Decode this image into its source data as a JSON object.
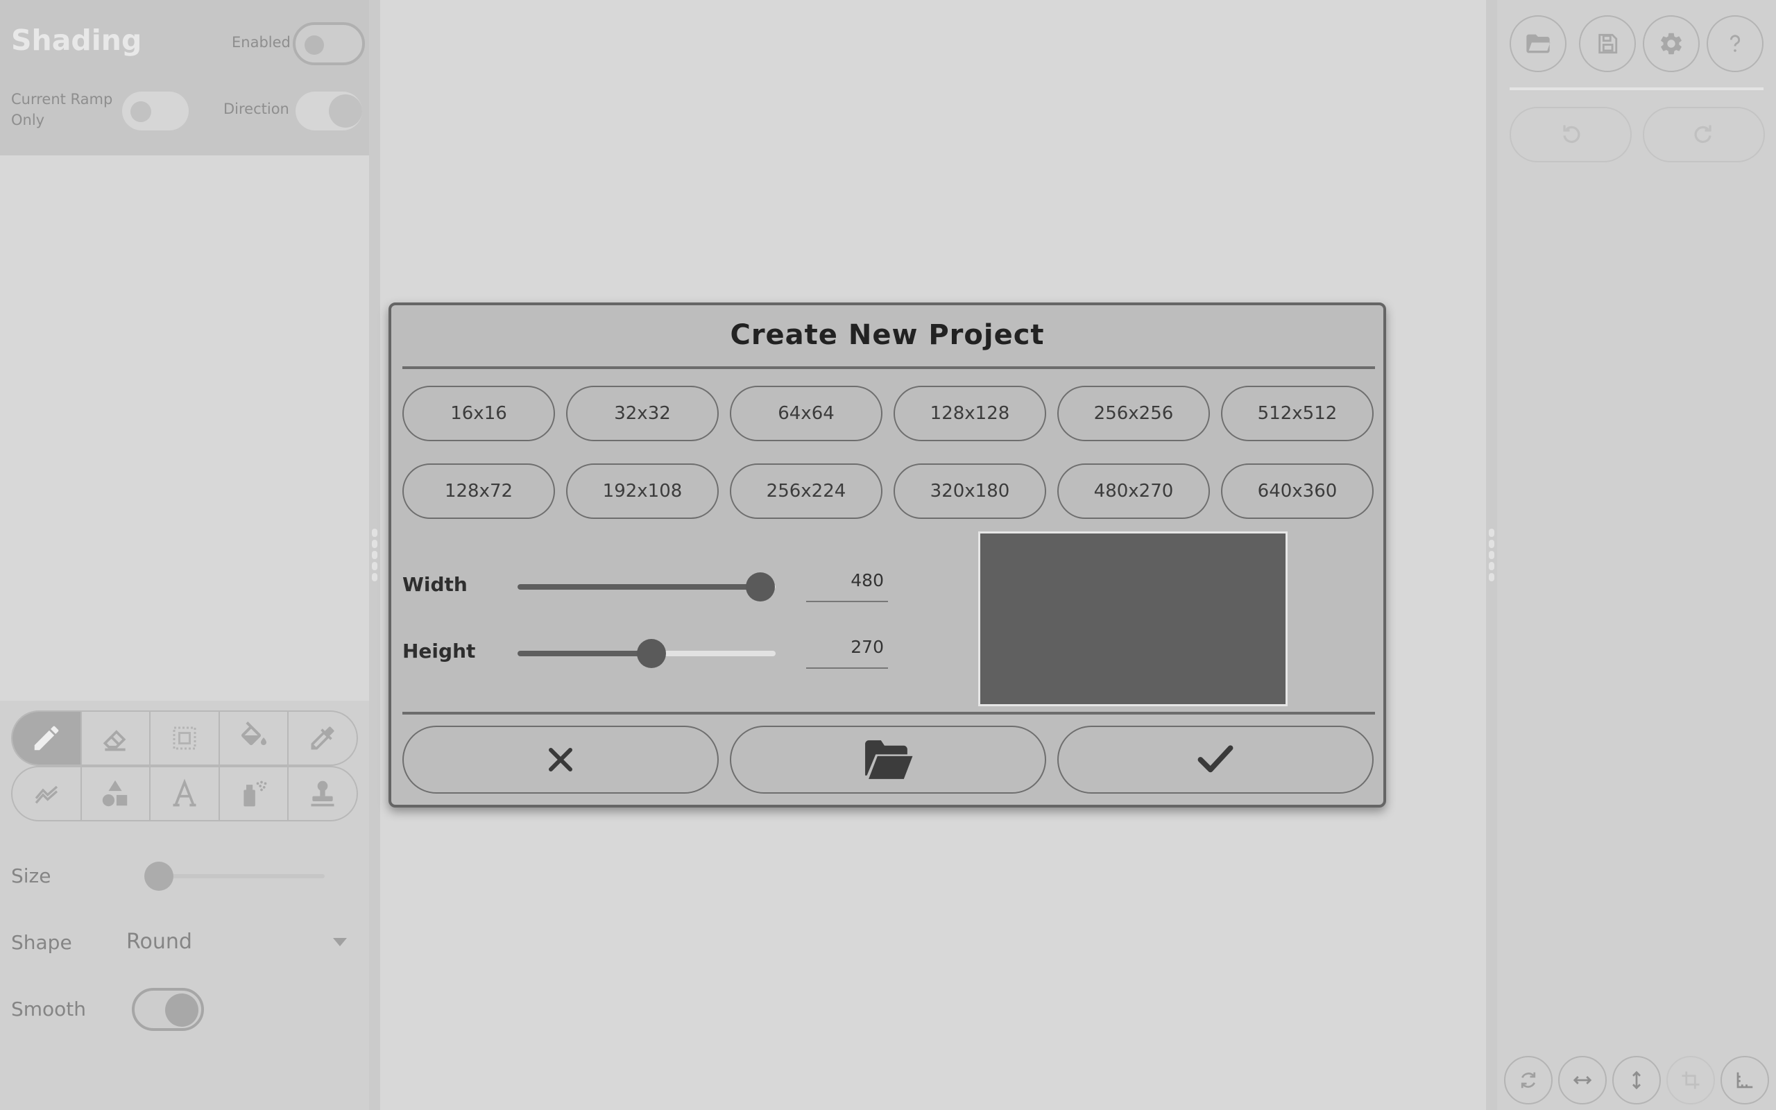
{
  "left_panel": {
    "shading": {
      "title": "Shading",
      "enabled_label": "Enabled",
      "current_ramp_line1": "Current Ramp",
      "current_ramp_line2": "Only",
      "direction_label": "Direction"
    },
    "tools_row1": [
      "pencil-icon",
      "eraser-icon",
      "selection-icon",
      "bucket-fill-icon",
      "eyedropper-icon"
    ],
    "tools_row2": [
      "shading-icon",
      "shapes-icon",
      "text-icon",
      "spray-icon",
      "stamp-icon"
    ],
    "active_tool": "pencil-icon",
    "brush": {
      "size_label": "Size",
      "size_value_fraction": 0.0,
      "shape_label": "Shape",
      "shape_value": "Round",
      "smooth_label": "Smooth",
      "smooth_on": true
    }
  },
  "right_panel": {
    "top_buttons": [
      "open-folder-icon",
      "save-icon",
      "settings-gear-icon",
      "help-question-icon"
    ],
    "history_buttons": [
      "undo-icon",
      "redo-icon"
    ],
    "bottom_buttons": [
      "rotate-icon",
      "flip-horizontal-icon",
      "flip-vertical-icon",
      "crop-icon",
      "ruler-icon"
    ]
  },
  "dialog": {
    "title": "Create New Project",
    "presets_row1": [
      "16x16",
      "32x32",
      "64x64",
      "128x128",
      "256x256",
      "512x512"
    ],
    "presets_row2": [
      "128x72",
      "192x108",
      "256x224",
      "320x180",
      "480x270",
      "640x360"
    ],
    "width_label": "Width",
    "width_value": "480",
    "width_fraction": 0.94,
    "height_label": "Height",
    "height_value": "270",
    "height_fraction": 0.52,
    "actions": [
      "cancel-x-icon",
      "open-folder-icon",
      "confirm-check-icon"
    ],
    "colors": {
      "dialog_bg": "#bdbdbd",
      "preview_canvas": "#606060",
      "border": "#656565"
    }
  }
}
